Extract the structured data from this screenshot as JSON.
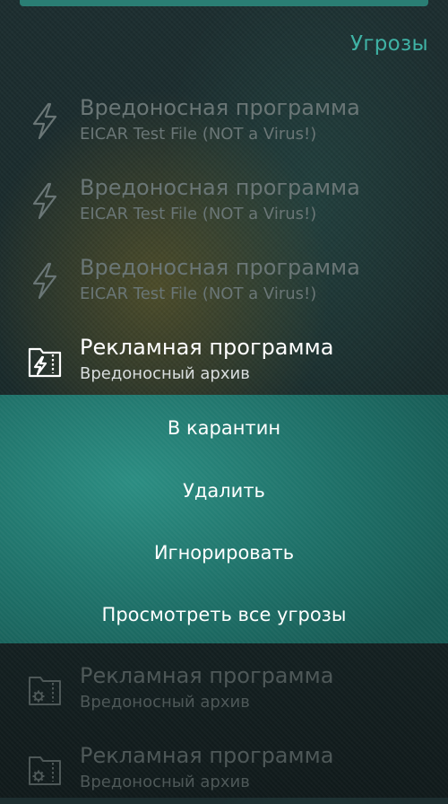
{
  "header": {
    "section_title": "Угрозы"
  },
  "threats": [
    {
      "title": "Вредоносная программа",
      "subtitle": "EICAR Test File (NOT a Virus!)",
      "icon": "lightning-icon"
    },
    {
      "title": "Вредоносная программа",
      "subtitle": "EICAR Test File (NOT a Virus!)",
      "icon": "lightning-icon"
    },
    {
      "title": "Вредоносная программа",
      "subtitle": "EICAR Test File (NOT a Virus!)",
      "icon": "lightning-icon"
    },
    {
      "title": "Рекламная программа",
      "subtitle": "Вредоносный архив",
      "icon": "archive-lightning-icon"
    },
    {
      "title": "Рекламная программа",
      "subtitle": "Вредоносный архив",
      "icon": "archive-gear-icon"
    },
    {
      "title": "Рекламная программа",
      "subtitle": "Вредоносный архив",
      "icon": "archive-gear-icon"
    }
  ],
  "context_menu": {
    "quarantine": "В карантин",
    "delete": "Удалить",
    "ignore": "Игнорировать",
    "view_all": "Просмотреть все угрозы"
  },
  "colors": {
    "accent": "#3fb2a5",
    "menu_background": "#2b8d82",
    "dim_text": "#6a7676"
  }
}
